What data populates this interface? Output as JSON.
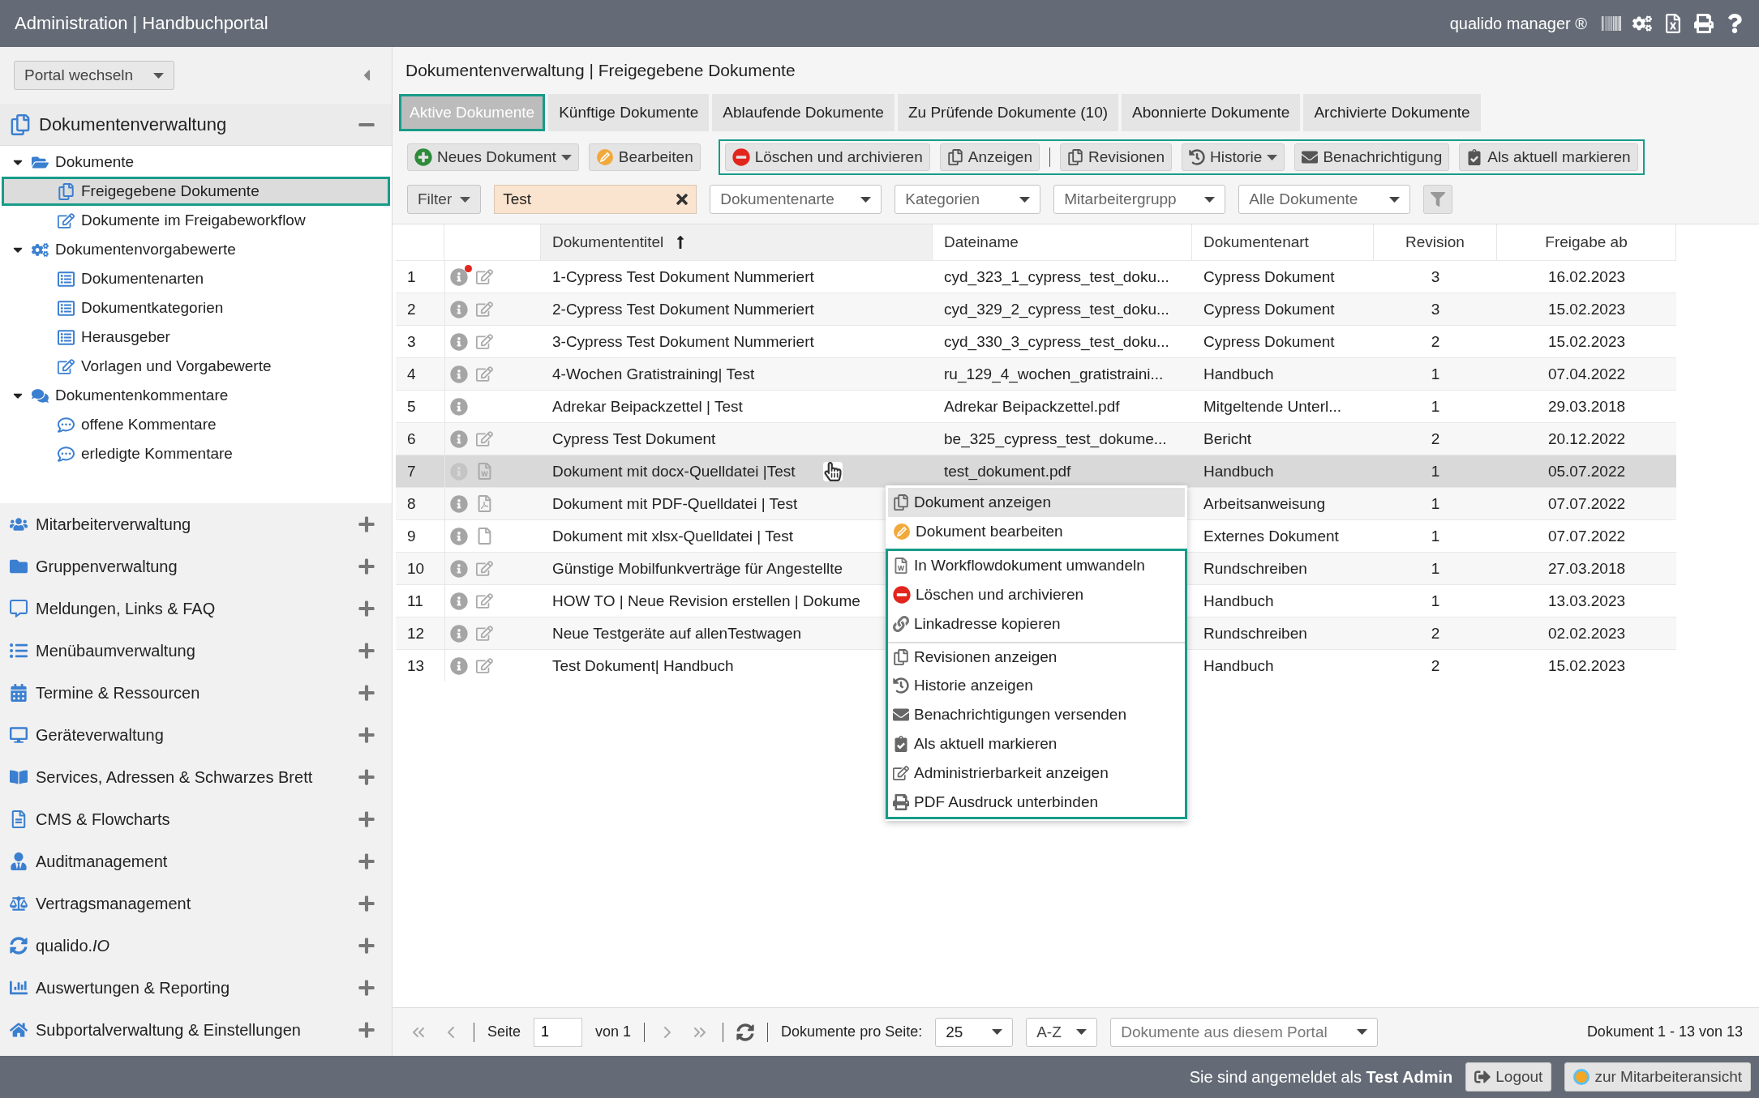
{
  "header": {
    "title": "Administration | Handbuchportal",
    "brand": "qualido manager ®"
  },
  "sidebar": {
    "portal_switch": "Portal wechseln",
    "sections": [
      {
        "label": "Dokumentenverwaltung",
        "expanded": true,
        "children": [
          {
            "label": "Dokumente",
            "expanded": true,
            "selected": false,
            "children": [
              {
                "label": "Freigegebene Dokumente",
                "selected": true
              },
              {
                "label": "Dokumente im Freigabeworkflow",
                "selected": false
              }
            ]
          },
          {
            "label": "Dokumentenvorgabewerte",
            "expanded": true,
            "selected": false,
            "children": [
              {
                "label": "Dokumentenarten",
                "selected": false
              },
              {
                "label": "Dokumentkategorien",
                "selected": false
              },
              {
                "label": "Herausgeber",
                "selected": false
              },
              {
                "label": "Vorlagen und Vorgabewerte",
                "selected": false
              }
            ]
          },
          {
            "label": "Dokumentenkommentare",
            "expanded": true,
            "selected": false,
            "children": [
              {
                "label": "offene Kommentare",
                "selected": false
              },
              {
                "label": "erledigte Kommentare",
                "selected": false
              }
            ]
          }
        ]
      },
      {
        "label": "Mitarbeiterverwaltung",
        "expanded": false
      },
      {
        "label": "Gruppenverwaltung",
        "expanded": false
      },
      {
        "label": "Meldungen, Links & FAQ",
        "expanded": false
      },
      {
        "label": "Menübaumverwaltung",
        "expanded": false
      },
      {
        "label": "Termine & Ressourcen",
        "expanded": false
      },
      {
        "label": "Geräteverwaltung",
        "expanded": false
      },
      {
        "label": "Services, Adressen & Schwarzes Brett",
        "expanded": false
      },
      {
        "label": "CMS & Flowcharts",
        "expanded": false
      },
      {
        "label": "Auditmanagement",
        "expanded": false
      },
      {
        "label": "Vertragsmanagement",
        "expanded": false
      },
      {
        "label": "qualido.*IO*",
        "expanded": false
      },
      {
        "label": "Auswertungen & Reporting",
        "expanded": false
      },
      {
        "label": "Subportalverwaltung & Einstellungen",
        "expanded": false
      }
    ]
  },
  "main": {
    "breadcrumb": "Dokumentenverwaltung | Freigegebene Dokumente",
    "tabs": [
      {
        "label": "Aktive Dokumente",
        "selected": true
      },
      {
        "label": "Künftige Dokumente",
        "selected": false
      },
      {
        "label": "Ablaufende Dokumente",
        "selected": false
      },
      {
        "label": "Zu Prüfende Dokumente (10)",
        "selected": false
      },
      {
        "label": "Abonnierte Dokumente",
        "selected": false
      },
      {
        "label": "Archivierte Dokumente",
        "selected": false
      }
    ],
    "toolbar": [
      {
        "outlined": false,
        "buttons": [
          {
            "label": "Neues Dokument",
            "dropdown": true,
            "separated": false
          },
          {
            "label": "Bearbeiten",
            "dropdown": false,
            "separated": false
          }
        ]
      },
      {
        "outlined": true,
        "buttons": [
          {
            "label": "Löschen und archivieren",
            "dropdown": false,
            "separated": false
          },
          {
            "label": "Anzeigen",
            "dropdown": false,
            "separated": false
          },
          {
            "label": "Revisionen",
            "dropdown": false,
            "separated": true
          },
          {
            "label": "Historie",
            "dropdown": true,
            "separated": false
          },
          {
            "label": "Benachrichtigung",
            "dropdown": false,
            "separated": false
          },
          {
            "label": "Als aktuell markieren",
            "dropdown": false,
            "separated": false
          }
        ]
      }
    ],
    "filters": {
      "filter": "Filter",
      "search": {
        "value": "Test"
      },
      "selects": [
        {
          "placeholder": "Dokumentenarte"
        },
        {
          "placeholder": "Kategorien"
        },
        {
          "placeholder": "Mitarbeitergrupp"
        },
        {
          "placeholder": "Alle Dokumente"
        }
      ]
    },
    "table": {
      "columns": [
        {
          "sorted": false
        },
        {
          "sorted": false
        },
        {
          "label": "Dokumententitel",
          "sorted": true
        },
        {
          "label": "Dateiname",
          "sorted": false
        },
        {
          "label": "Dokumentenart",
          "sorted": false
        },
        {
          "label": "Revision",
          "sorted": false
        },
        {
          "label": "Freigabe ab",
          "sorted": false
        }
      ],
      "rows": [
        {
          "num": "1",
          "alert": true,
          "kind": "edit",
          "title": "1-Cypress Test Dokument Nummeriert",
          "filename": "cyd_323_1_cypress_test_doku...",
          "type": "Cypress Dokument",
          "revision": "3",
          "date": "16.02.2023",
          "selected": false
        },
        {
          "num": "2",
          "alert": false,
          "kind": "edit",
          "title": "2-Cypress Test Dokument Nummeriert",
          "filename": "cyd_329_2_cypress_test_doku...",
          "type": "Cypress Dokument",
          "revision": "3",
          "date": "15.02.2023",
          "selected": false
        },
        {
          "num": "3",
          "alert": false,
          "kind": "edit",
          "title": "3-Cypress Test Dokument Nummeriert",
          "filename": "cyd_330_3_cypress_test_doku...",
          "type": "Cypress Dokument",
          "revision": "2",
          "date": "15.02.2023",
          "selected": false
        },
        {
          "num": "4",
          "alert": false,
          "kind": "edit",
          "title": "4-Wochen Gratistraining| Test",
          "filename": "ru_129_4_wochen_gratistraini...",
          "type": "Handbuch",
          "revision": "1",
          "date": "07.04.2022",
          "selected": false
        },
        {
          "num": "5",
          "alert": false,
          "kind": "none",
          "title": "Adrekar Beipackzettel | Test",
          "filename": "Adrekar Beipackzettel.pdf",
          "type": "Mitgeltende Unterl...",
          "revision": "1",
          "date": "29.03.2018",
          "selected": false
        },
        {
          "num": "6",
          "alert": false,
          "kind": "edit",
          "title": "Cypress Test Dokument",
          "filename": "be_325_cypress_test_dokume...",
          "type": "Bericht",
          "revision": "2",
          "date": "20.12.2022",
          "selected": false
        },
        {
          "num": "7",
          "alert": false,
          "kind": "docx",
          "title": "Dokument mit docx-Quelldatei |Test",
          "filename": "test_dokument.pdf",
          "type": "Handbuch",
          "revision": "1",
          "date": "05.07.2022",
          "selected": true
        },
        {
          "num": "8",
          "alert": false,
          "kind": "pdf",
          "title": "Dokument mit PDF-Quelldatei | Test",
          "type": "Arbeitsanweisung",
          "revision": "1",
          "date": "07.07.2022",
          "selected": false
        },
        {
          "num": "9",
          "alert": false,
          "kind": "file",
          "title": "Dokument mit xlsx-Quelldatei | Test",
          "type": "Externes Dokument",
          "revision": "1",
          "date": "07.07.2022",
          "selected": false
        },
        {
          "num": "10",
          "alert": false,
          "kind": "edit",
          "title": "Günstige Mobilfunkverträge für Angestellte",
          "type": "Rundschreiben",
          "revision": "1",
          "date": "27.03.2018",
          "selected": false
        },
        {
          "num": "11",
          "alert": false,
          "kind": "edit",
          "title": "HOW TO | Neue Revision erstellen | Dokume",
          "type": "Handbuch",
          "revision": "1",
          "date": "13.03.2023",
          "selected": false
        },
        {
          "num": "12",
          "alert": false,
          "kind": "edit",
          "title": "Neue Testgeräte auf allenTestwagen",
          "type": "Rundschreiben",
          "revision": "2",
          "date": "02.02.2023",
          "selected": false
        },
        {
          "num": "13",
          "alert": false,
          "kind": "edit",
          "title": "Test Dokument| Handbuch",
          "type": "Handbuch",
          "revision": "2",
          "date": "15.02.2023",
          "selected": false
        }
      ]
    },
    "context_menu": [
      {
        "outlined": false,
        "items": [
          {
            "label": "Dokument anzeigen",
            "selected": true,
            "separated": false
          },
          {
            "label": "Dokument bearbeiten",
            "selected": false,
            "separated": false
          }
        ]
      },
      {
        "outlined": true,
        "items": [
          {
            "label": "In Workflowdokument umwandeln",
            "selected": false,
            "separated": false
          },
          {
            "label": "Löschen und archivieren",
            "selected": false,
            "separated": false
          },
          {
            "label": "Linkadresse kopieren",
            "selected": false,
            "separated": false
          },
          {
            "label": "Revisionen anzeigen",
            "selected": false,
            "separated": true
          },
          {
            "label": "Historie anzeigen",
            "selected": false,
            "separated": false
          },
          {
            "label": "Benachrichtigungen versenden",
            "selected": false,
            "separated": false
          },
          {
            "label": "Als aktuell markieren",
            "selected": false,
            "separated": false
          },
          {
            "label": "Administrierbarkeit anzeigen",
            "selected": false,
            "separated": false
          },
          {
            "label": "PDF Ausdruck unterbinden",
            "selected": false,
            "separated": false
          }
        ]
      }
    ],
    "pager": {
      "page_label": "Seite",
      "page": "1",
      "of": "von 1",
      "per_page_label": "Dokumente pro Seite:",
      "per_page": "25",
      "sort": "A-Z",
      "scope": "Dokumente aus diesem Portal",
      "summary": "Dokument 1 - 13 von 13"
    }
  },
  "footer": {
    "login": "Sie sind angemeldet als **Test Admin**",
    "logout": "Logout",
    "switch_view": "zur Mitarbeiteransicht"
  }
}
